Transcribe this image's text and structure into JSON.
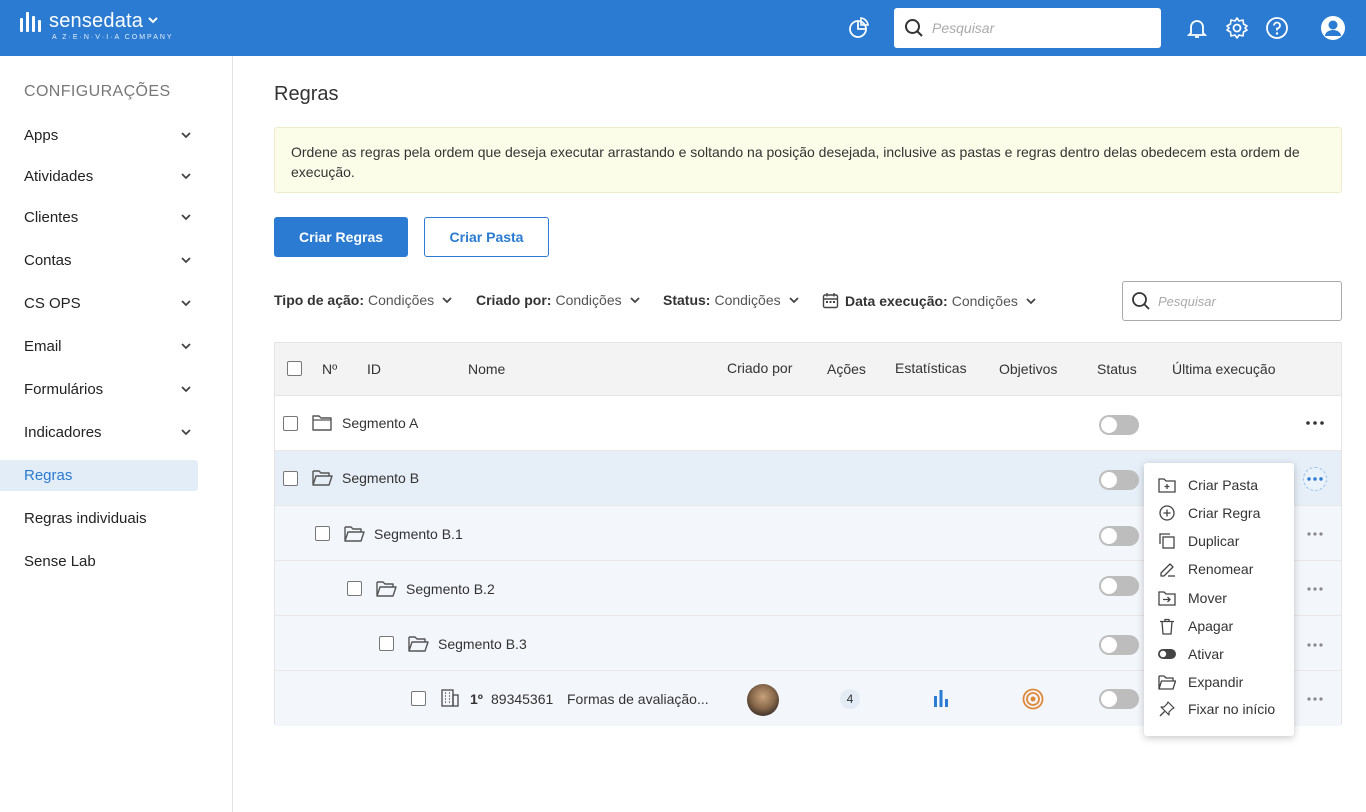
{
  "brand": {
    "name": "sensedata",
    "tagline": "A Z·E·N·V·I·A COMPANY"
  },
  "topbar": {
    "search_placeholder": "Pesquisar",
    "icons": [
      "dashboard-icon",
      "bell-icon",
      "gear-icon",
      "help-icon",
      "user-icon"
    ]
  },
  "sidebar": {
    "title": "CONFIGURAÇÕES",
    "items": [
      {
        "label": "Apps",
        "expandable": true
      },
      {
        "label": "Atividades",
        "expandable": true
      },
      {
        "label": "Clientes",
        "expandable": true
      },
      {
        "label": "Contas",
        "expandable": true
      },
      {
        "label": "CS OPS",
        "expandable": true
      },
      {
        "label": "Email",
        "expandable": true
      },
      {
        "label": "Formulários",
        "expandable": true
      },
      {
        "label": "Indicadores",
        "expandable": true
      },
      {
        "label": "Regras",
        "expandable": false,
        "active": true
      },
      {
        "label": "Regras individuais",
        "expandable": false
      },
      {
        "label": "Sense Lab",
        "expandable": false
      }
    ]
  },
  "main": {
    "title": "Regras",
    "info": "Ordene as regras pela ordem que deseja executar arrastando e soltando na posição desejada, inclusive as pastas e regras dentro delas obedecem esta ordem de execução.",
    "buttons": {
      "create_rules": "Criar Regras",
      "create_folder": "Criar Pasta"
    },
    "filters": [
      {
        "label": "Tipo de ação:",
        "value": "Condições"
      },
      {
        "label": "Criado por:",
        "value": "Condições"
      },
      {
        "label": "Status:",
        "value": "Condições"
      },
      {
        "label": "Data execução:",
        "value": "Condições"
      }
    ],
    "search_placeholder": "Pesquisar"
  },
  "table": {
    "headers": {
      "num": "Nº",
      "id": "ID",
      "name": "Nome",
      "created_by": "Criado por",
      "actions": "Ações",
      "stats": "Estatísticas",
      "goals": "Objetivos",
      "status": "Status",
      "last_run": "Última execução"
    },
    "rows": [
      {
        "type": "folder",
        "name": "Segmento A",
        "level": 0,
        "status": "off"
      },
      {
        "type": "folder-open",
        "name": "Segmento B",
        "level": 0,
        "status": "off",
        "highlighted": true
      },
      {
        "type": "folder-open",
        "name": "Segmento B.1",
        "level": 1,
        "status": "off"
      },
      {
        "type": "folder-open",
        "name": "Segmento B.2",
        "level": 2,
        "status": "off"
      },
      {
        "type": "folder-open",
        "name": "Segmento B.3",
        "level": 3,
        "status": "off"
      },
      {
        "type": "rule",
        "num": "1º",
        "id": "89345361",
        "name": "Formas de avaliação...",
        "actions": "4",
        "level": 4,
        "status": "off"
      }
    ]
  },
  "context_menu": {
    "items": [
      {
        "label": "Criar Pasta",
        "icon": "folder-plus-icon"
      },
      {
        "label": "Criar Regra",
        "icon": "plus-circle-icon"
      },
      {
        "label": "Duplicar",
        "icon": "duplicate-icon"
      },
      {
        "label": "Renomear",
        "icon": "pencil-icon"
      },
      {
        "label": "Mover",
        "icon": "folder-move-icon"
      },
      {
        "label": "Apagar",
        "icon": "trash-icon"
      },
      {
        "label": "Ativar",
        "icon": "toggle-icon"
      },
      {
        "label": "Expandir",
        "icon": "folder-open-icon"
      },
      {
        "label": "Fixar no início",
        "icon": "pin-icon"
      }
    ]
  },
  "colors": {
    "primary": "#2a7bd1",
    "info_bg": "#fcfde9",
    "highlight_row": "#e6eef7",
    "stats": "#2a7bd1",
    "goal": "#e0883a"
  }
}
